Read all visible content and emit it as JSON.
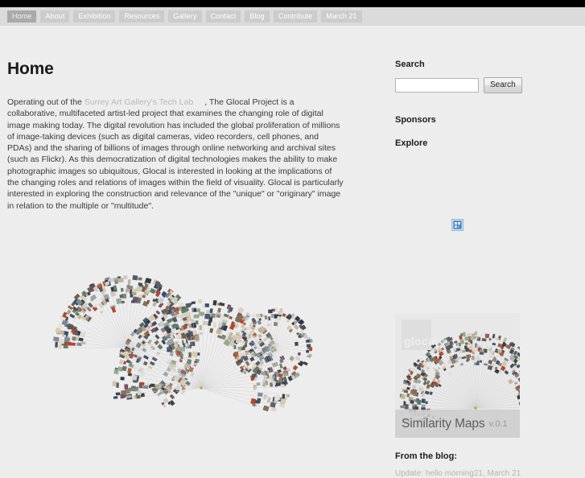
{
  "nav": {
    "items": [
      {
        "label": "Home",
        "active": true
      },
      {
        "label": "About",
        "active": false
      },
      {
        "label": "Exhibition",
        "active": false
      },
      {
        "label": "Resources",
        "active": false
      },
      {
        "label": "Gallery",
        "active": false
      },
      {
        "label": "Contact",
        "active": false
      },
      {
        "label": "Blog",
        "active": false
      },
      {
        "label": "Contribute",
        "active": false
      },
      {
        "label": "March 21",
        "active": false
      }
    ]
  },
  "main": {
    "title": "Home",
    "intro": {
      "before_link": "Operating out of the ",
      "link_text": "Surrey Art Gallery's Tech Lab",
      "after_link": ", The Glocal Project is a collaborative, multifaceted artist-led project that examines the changing role of digital image making today. The digital revolution has included the global proliferation of millions of image-taking devices (such as digital cameras, video recorders, cell phones, and PDAs) and the sharing of billions of images through online networking and archival sites (such as Flickr). As this democratization of digital technologies makes the ability to make photographic images so ubiquitous, Glocal is interested in looking at the implications of the changing roles and relations of images within the field of visuality. Glocal is particularly interested in exploring the construction and relevance of the \"unique\" or \"originary\" image in relation to the multiple or \"multitude\"."
    },
    "artwork_alt": "similarity-map-visualization"
  },
  "sidebar": {
    "search": {
      "heading": "Search",
      "value": "",
      "placeholder": "",
      "button_label": "Search"
    },
    "sponsors_heading": "Sponsors",
    "explore_heading": "Explore",
    "broken_image_alt": "missing-image",
    "promo": {
      "logo_text": "glocal",
      "title": "Similarity Maps",
      "version": "v.0.1"
    },
    "blog": {
      "heading": "From the blog:",
      "first_item": "Update: hello morning21, March 21"
    }
  },
  "colors": {
    "page_background": "#ededed",
    "topbar": "#000000",
    "nav_strip": "#dbdbdb",
    "nav_tab": "#cccccc",
    "nav_tab_active": "#aaaaaa",
    "heading_text": "#1a1a1a",
    "body_text": "#3a3a3a",
    "link_muted": "#b9b9b9",
    "promo_panel": "#e8e8e8",
    "promo_caption": "#cdcdcd",
    "broken_image_icon": "#3a7ebf"
  }
}
